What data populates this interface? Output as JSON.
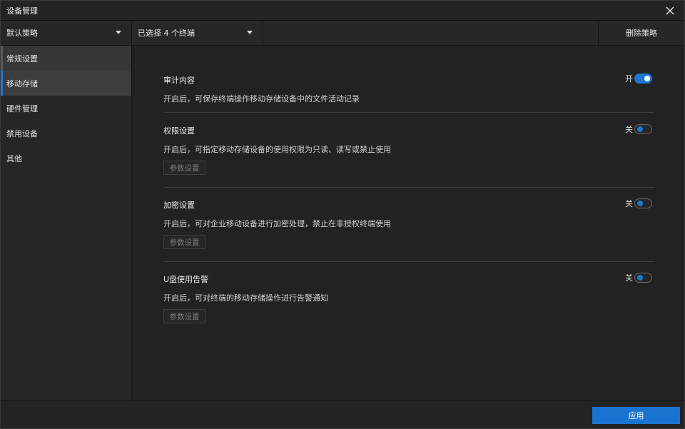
{
  "window": {
    "title": "设备管理"
  },
  "toolbar": {
    "policy_select": "默认策略",
    "terminals_select": "已选择 4 个终端",
    "delete_policy": "删除策略"
  },
  "sidebar": {
    "items": [
      {
        "label": "常规设置"
      },
      {
        "label": "移动存储"
      },
      {
        "label": "硬件管理"
      },
      {
        "label": "禁用设备"
      },
      {
        "label": "其他"
      }
    ]
  },
  "sections": [
    {
      "title": "审计内容",
      "toggle_label": "开",
      "enabled": true,
      "description": "开启后，可保存终端操作移动存储设备中的文件活动记录"
    },
    {
      "title": "权限设置",
      "toggle_label": "关",
      "enabled": false,
      "description": "开启后，可指定移动存储设备的使用权限为只读、读写或禁止使用",
      "button": "参数设置"
    },
    {
      "title": "加密设置",
      "toggle_label": "关",
      "enabled": false,
      "description": "开启后，可对企业移动设备进行加密处理，禁止在非授权终端使用",
      "button": "参数设置"
    },
    {
      "title": "U盘使用告警",
      "toggle_label": "关",
      "enabled": false,
      "description": "开启后，可对终端的移动存储操作进行告警通知",
      "button": "参数设置"
    }
  ],
  "footer": {
    "apply": "应用"
  },
  "colors": {
    "accent": "#1a74cf",
    "background": "#1f1f1f"
  },
  "icons": {
    "close": "close-icon",
    "dropdown": "caret-down-icon"
  }
}
